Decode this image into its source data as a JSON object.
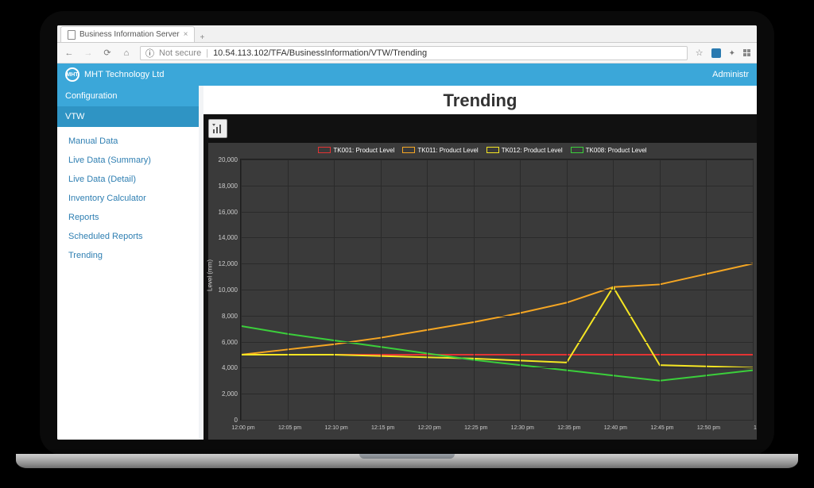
{
  "browser": {
    "tab_title": "Business Information Server",
    "secure_label": "Not secure",
    "url": "10.54.113.102/TFA/BusinessInformation/VTW/Trending"
  },
  "header": {
    "brand": "MHT Technology Ltd",
    "user_label": "Administr"
  },
  "sidebar": {
    "section1": "Configuration",
    "section2": "VTW",
    "items": [
      {
        "label": "Manual Data"
      },
      {
        "label": "Live Data (Summary)"
      },
      {
        "label": "Live Data (Detail)"
      },
      {
        "label": "Inventory Calculator"
      },
      {
        "label": "Reports"
      },
      {
        "label": "Scheduled Reports"
      },
      {
        "label": "Trending"
      }
    ]
  },
  "page": {
    "title": "Trending"
  },
  "chart_data": {
    "type": "line",
    "title": "",
    "xlabel": "",
    "ylabel": "Level (mm)",
    "ylim": [
      0,
      20000
    ],
    "x_categories": [
      "12:00 pm",
      "12:05 pm",
      "12:10 pm",
      "12:15 pm",
      "12:20 pm",
      "12:25 pm",
      "12:30 pm",
      "12:35 pm",
      "12:40 pm",
      "12:45 pm",
      "12:50 pm",
      "1"
    ],
    "y_ticks": [
      0,
      2000,
      4000,
      6000,
      8000,
      10000,
      12000,
      14000,
      16000,
      18000,
      20000
    ],
    "y_tick_labels": [
      "0",
      "2,000",
      "4,000",
      "6,000",
      "8,000",
      "10,000",
      "12,000",
      "14,000",
      "16,000",
      "18,000",
      "20,000"
    ],
    "series": [
      {
        "name": "TK001: Product Level",
        "color": "#e33333",
        "values": [
          5000,
          5000,
          5000,
          5000,
          5000,
          5000,
          5000,
          5000,
          5000,
          5000,
          5000,
          5000
        ]
      },
      {
        "name": "TK011: Product Level",
        "color": "#f5a623",
        "values": [
          5000,
          5400,
          5800,
          6300,
          6900,
          7500,
          8200,
          9000,
          10200,
          10400,
          11200,
          12000
        ]
      },
      {
        "name": "TK012: Product Level",
        "color": "#f5e623",
        "values": [
          5000,
          5000,
          5000,
          4900,
          4800,
          4700,
          4550,
          4400,
          10200,
          4200,
          4100,
          4000
        ]
      },
      {
        "name": "TK008: Product Level",
        "color": "#3bcf3b",
        "values": [
          7200,
          6600,
          6100,
          5600,
          5100,
          4600,
          4200,
          3800,
          3400,
          3000,
          3400,
          3800
        ]
      }
    ]
  }
}
